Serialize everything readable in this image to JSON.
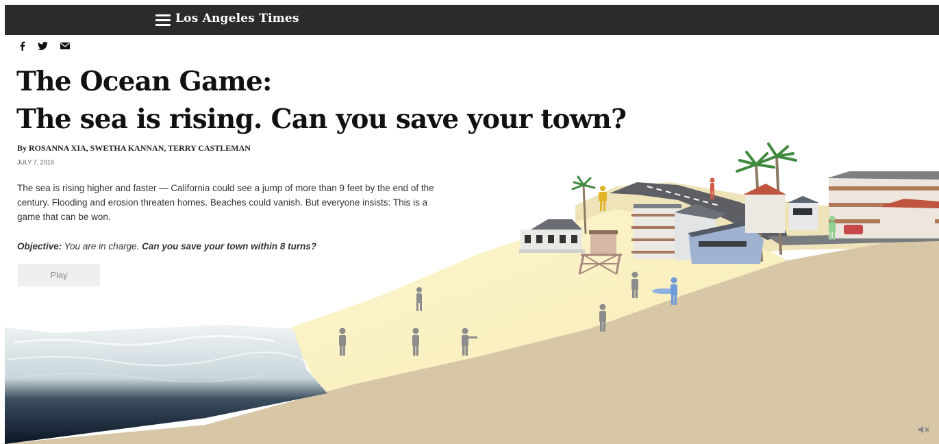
{
  "header": {
    "logo": "Los Angeles Times"
  },
  "article": {
    "headline_line1": "The Ocean Game:",
    "headline_line2": "The sea is rising. Can you save your town?",
    "byline": "By ROSANNA XIA, SWETHA KANNAN, TERRY CASTLEMAN",
    "date": "JULY 7, 2019",
    "intro": "The sea is rising higher and faster — California could see a jump of more than 9 feet by the end of the century. Flooding and erosion threaten homes. Beaches could vanish. But everyone insists: This is a game that can be won.",
    "objective_label": "Objective:",
    "objective_text": " You are in charge. ",
    "objective_question": "Can you save your town within 8 turns?"
  },
  "game": {
    "play_label": "Play"
  },
  "icons": {
    "menu": "hamburger-icon",
    "share": [
      "facebook-icon",
      "twitter-icon",
      "email-icon"
    ],
    "sound": "mute-icon"
  },
  "colors": {
    "topbar": "#2b2b2b",
    "sand_dry": "#d6c6a6",
    "sand_light": "#fcf3c4",
    "ocean_dark": "#0e1a2a",
    "ocean_foam": "#e4ecee",
    "person_gray": "#8c8c8c",
    "person_blue": "#6f9bd8",
    "person_yellow": "#e0b52a",
    "person_green": "#8fcf8f",
    "person_red": "#d45a4a"
  }
}
